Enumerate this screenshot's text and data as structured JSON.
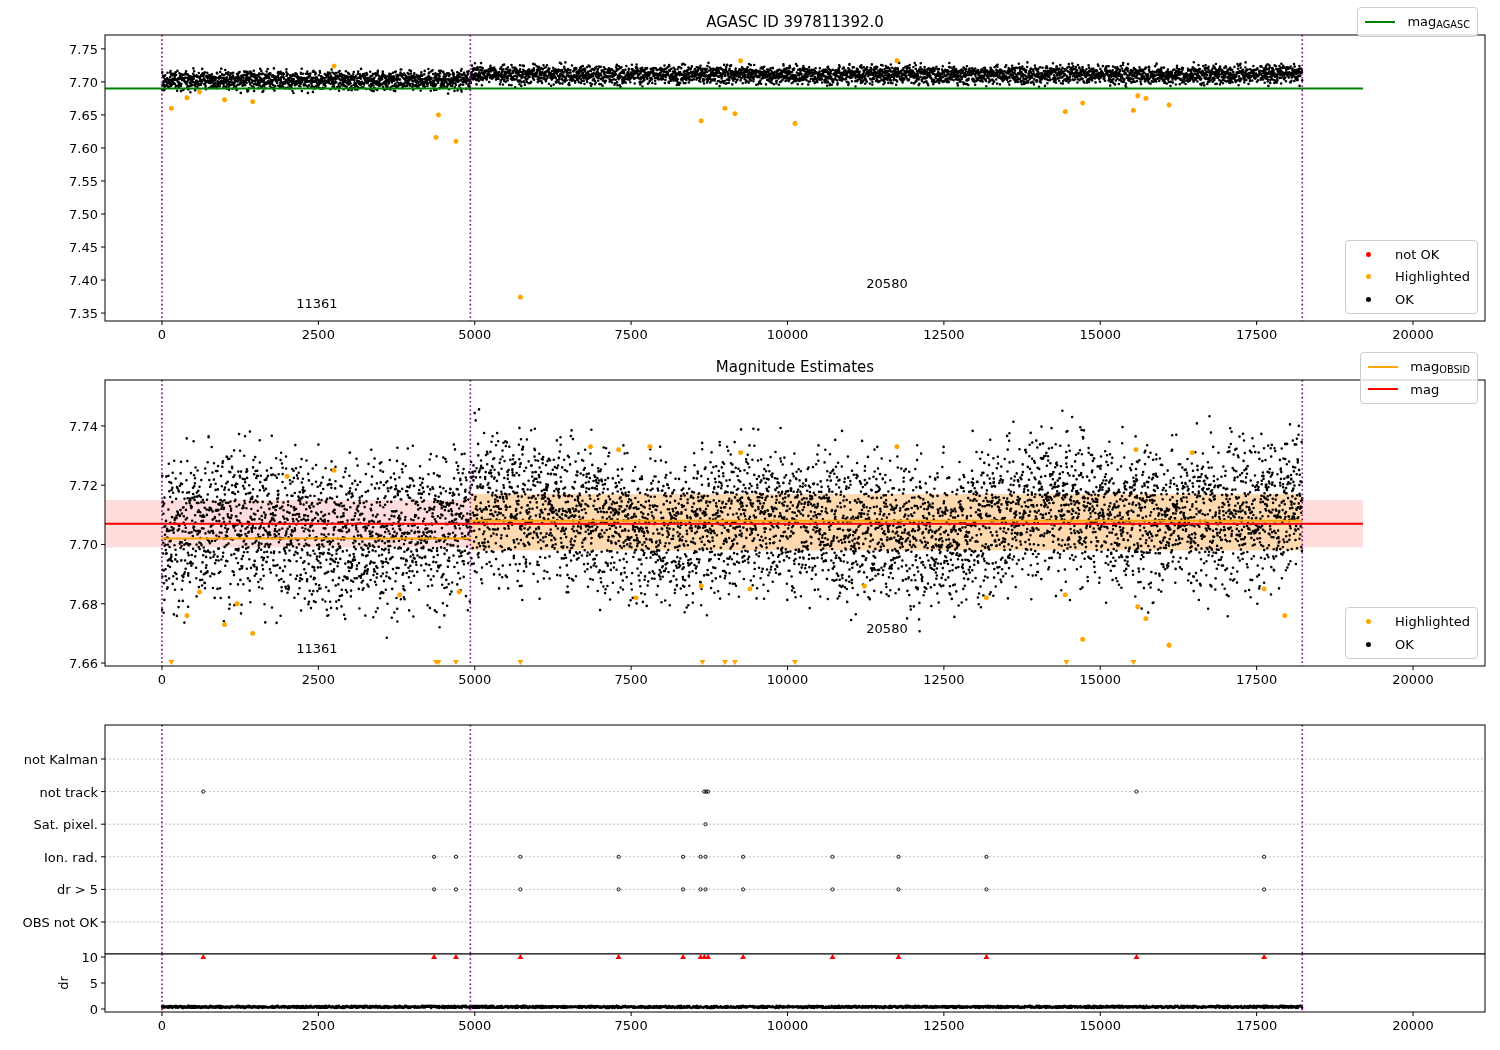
{
  "panels": [
    {
      "kind": "magnitude",
      "markers": [
        {
          "kind": "points"
        }
      ],
      "chart_data": {
        "type": "scatter",
        "title": "AGASC ID 397811392.0",
        "xlim": [
          -911,
          21151
        ],
        "ylim": [
          7.338,
          7.771
        ],
        "xticks": [
          {
            "value": 0,
            "label": "0"
          },
          {
            "value": 2500,
            "label": "2500"
          },
          {
            "value": 5000,
            "label": "5000"
          },
          {
            "value": 7500,
            "label": "7500"
          },
          {
            "value": 10000,
            "label": "10000"
          },
          {
            "value": 12500,
            "label": "12500"
          },
          {
            "value": 15000,
            "label": "15000"
          },
          {
            "value": 17500,
            "label": "17500"
          },
          {
            "value": 20000,
            "label": "20000"
          }
        ],
        "yticks": [
          {
            "value": 7.35,
            "label": "7.35"
          },
          {
            "value": 7.4,
            "label": "7.40"
          },
          {
            "value": 7.45,
            "label": "7.45"
          },
          {
            "value": 7.5,
            "label": "7.50"
          },
          {
            "value": 7.55,
            "label": "7.55"
          },
          {
            "value": 7.6,
            "label": "7.60"
          },
          {
            "value": 7.65,
            "label": "7.65"
          },
          {
            "value": 7.7,
            "label": "7.70"
          },
          {
            "value": 7.75,
            "label": "7.75"
          }
        ],
        "x": [
          150,
          400,
          600,
          1000,
          1450,
          2750,
          4380,
          4420,
          4700,
          5730,
          8620,
          9000,
          9160,
          9250,
          10120,
          11750,
          14440,
          14720,
          15530,
          15600,
          15730,
          16100
        ],
        "series": [
          {
            "color": "#ffa500",
            "values": [
              7.66,
              7.676,
              7.685,
              7.673,
              7.67,
              7.724,
              7.616,
              7.65,
              7.61,
              7.374,
              7.641,
              7.66,
              7.652,
              7.732,
              7.637,
              7.732,
              7.655,
              7.668,
              7.657,
              7.679,
              7.675,
              7.665
            ]
          }
        ],
        "ref_lines": [
          {
            "axis": "y",
            "value": 7.69,
            "color": "#008000"
          },
          {
            "axis": "x",
            "value": 0,
            "color": "#800080"
          },
          {
            "axis": "x",
            "value": 4930,
            "color": "#800080"
          },
          {
            "axis": "x",
            "value": 18230,
            "color": "#800080"
          }
        ],
        "annotations": [
          "11361",
          "20580"
        ]
      },
      "legends": [
        {
          "entries": [
            {
              "label": "mag$_{AGASC}$",
              "kind": "line",
              "color": "#008000"
            }
          ]
        },
        {
          "entries": [
            {
              "label": "not OK",
              "kind": "dot",
              "color": "#ff0000"
            },
            {
              "label": "Highlighted",
              "kind": "dot",
              "color": "#ffa500"
            },
            {
              "label": "OK",
              "kind": "dot",
              "color": "#000000"
            }
          ]
        }
      ]
    },
    {
      "kind": "estimates",
      "markers": [
        {
          "kind": "points"
        },
        {
          "kind": "triangles"
        }
      ],
      "chart_data": {
        "type": "scatter",
        "title": "Magnitude Estimates",
        "xlim": [
          -911,
          21151
        ],
        "ylim": [
          7.659,
          7.7555
        ],
        "xticks": [
          {
            "value": 0,
            "label": "0"
          },
          {
            "value": 2500,
            "label": "2500"
          },
          {
            "value": 5000,
            "label": "5000"
          },
          {
            "value": 7500,
            "label": "7500"
          },
          {
            "value": 10000,
            "label": "10000"
          },
          {
            "value": 12500,
            "label": "12500"
          },
          {
            "value": 15000,
            "label": "15000"
          },
          {
            "value": 17500,
            "label": "17500"
          },
          {
            "value": 20000,
            "label": "20000"
          }
        ],
        "yticks": [
          {
            "value": 7.66,
            "label": "7.66"
          },
          {
            "value": 7.68,
            "label": "7.68"
          },
          {
            "value": 7.7,
            "label": "7.70"
          },
          {
            "value": 7.72,
            "label": "7.72"
          },
          {
            "value": 7.74,
            "label": "7.74"
          }
        ],
        "x": [
          150,
          400,
          600,
          1000,
          1200,
          1450,
          2000,
          2750,
          3800,
          4380,
          4420,
          4700,
          4750,
          5730,
          6850,
          7300,
          7580,
          7800,
          8620,
          8640,
          9000,
          9160,
          9250,
          9400,
          10120,
          11230,
          11750,
          13180,
          14440,
          14460,
          14720,
          15530,
          15570,
          15600,
          15730,
          16100,
          16470,
          17620,
          17950
        ],
        "series": [
          {
            "color": "#ffa500",
            "values": [
              null,
              7.676,
              7.684,
              7.673,
              7.68,
              7.67,
              7.723,
              7.725,
              7.683,
              null,
              null,
              null,
              7.684,
              null,
              7.733,
              7.732,
              7.682,
              7.733,
              7.686,
              null,
              null,
              null,
              7.731,
              7.685,
              null,
              7.686,
              7.733,
              7.682,
              7.683,
              null,
              7.668,
              null,
              7.732,
              7.679,
              7.675,
              7.666,
              7.731,
              7.685,
              7.676
            ]
          },
          {
            "color": "#ffa500",
            "values": [
              7.66,
              null,
              null,
              null,
              null,
              null,
              null,
              null,
              null,
              7.66,
              7.66,
              7.66,
              null,
              7.66,
              null,
              null,
              null,
              null,
              null,
              7.66,
              7.66,
              7.66,
              null,
              null,
              7.66,
              null,
              null,
              null,
              null,
              7.66,
              null,
              7.66,
              null,
              null,
              null,
              null,
              null,
              null,
              null
            ]
          }
        ],
        "bands": [
          {
            "axis": "y",
            "from": 7.699,
            "to": 7.715,
            "color": "#ffdddd"
          },
          {
            "axis": "y",
            "from": 7.698,
            "to": 7.717,
            "color": "#ffd9b0"
          }
        ],
        "ref_lines": [
          {
            "axis": "y",
            "value": 7.707,
            "color": "#ff0000"
          },
          {
            "axis": "y",
            "value": 7.702,
            "color": "#ffa500"
          },
          {
            "axis": "y",
            "value": 7.708,
            "color": "#ffa500"
          },
          {
            "axis": "x",
            "value": 0,
            "color": "#800080"
          },
          {
            "axis": "x",
            "value": 4930,
            "color": "#800080"
          },
          {
            "axis": "x",
            "value": 18230,
            "color": "#800080"
          }
        ],
        "annotations": [
          "11361",
          "20580"
        ]
      },
      "legends": [
        {
          "entries": [
            {
              "label": "mag$_{OBSID}$",
              "kind": "line",
              "color": "#ffa500"
            },
            {
              "label": "mag",
              "kind": "line",
              "color": "#ff0000"
            }
          ]
        },
        {
          "entries": [
            {
              "label": "Highlighted",
              "kind": "dot",
              "color": "#ffa500"
            },
            {
              "label": "OK",
              "kind": "dot",
              "color": "#000000"
            }
          ]
        }
      ]
    },
    {
      "kind": "flags",
      "row_labels": [
        "not Kalman",
        "not track",
        "Sat. pixel.",
        "Ion. rad.",
        "dr > 5",
        "OBS not OK"
      ]
    },
    {
      "kind": "dr",
      "chart_data": {
        "type": "scatter",
        "xlim": [
          -911,
          21151
        ],
        "ylim": [
          -0.58,
          10.58
        ],
        "ylabel": "dr",
        "xticks": [
          {
            "value": 0,
            "label": "0"
          },
          {
            "value": 2500,
            "label": "2500"
          },
          {
            "value": 5000,
            "label": "5000"
          },
          {
            "value": 7500,
            "label": "7500"
          },
          {
            "value": 10000,
            "label": "10000"
          },
          {
            "value": 12500,
            "label": "12500"
          },
          {
            "value": 15000,
            "label": "15000"
          },
          {
            "value": 17500,
            "label": "17500"
          },
          {
            "value": 20000,
            "label": "20000"
          }
        ],
        "yticks": [
          {
            "value": 0,
            "label": "0"
          },
          {
            "value": 5,
            "label": "5"
          },
          {
            "value": 10,
            "label": "10"
          }
        ],
        "x": [
          660,
          4350,
          4700,
          5730,
          7300,
          8330,
          8610,
          8670,
          8730,
          9290,
          10720,
          11775,
          13180,
          15580,
          17620
        ],
        "series": [
          {
            "color": "#ff0000",
            "values": [
              10,
              10,
              10,
              10,
              10,
              10,
              10,
              10,
              10,
              10,
              10,
              10,
              10,
              10,
              10
            ]
          }
        ],
        "ref_lines": [
          {
            "axis": "x",
            "value": 0,
            "color": "#800080"
          },
          {
            "axis": "x",
            "value": 4930,
            "color": "#800080"
          },
          {
            "axis": "x",
            "value": 18230,
            "color": "#800080"
          }
        ]
      }
    }
  ]
}
